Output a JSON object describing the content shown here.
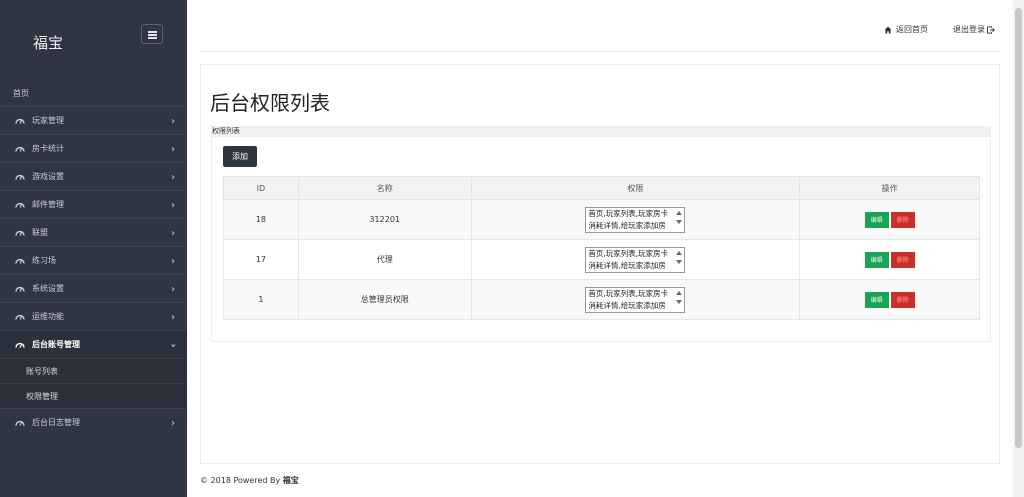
{
  "sidebar": {
    "brand": "福宝",
    "home": "首页",
    "items": [
      {
        "label": "玩家管理"
      },
      {
        "label": "房卡统计"
      },
      {
        "label": "游戏设置"
      },
      {
        "label": "邮件管理"
      },
      {
        "label": "联盟"
      },
      {
        "label": "练习场"
      },
      {
        "label": "系统设置"
      },
      {
        "label": "运维功能"
      },
      {
        "label": "后台账号管理"
      }
    ],
    "sub_items": [
      {
        "label": "账号列表"
      },
      {
        "label": "权限管理"
      }
    ],
    "last_item": {
      "label": "后台日志管理"
    }
  },
  "topbar": {
    "home_label": "返回首页",
    "logout_label": "退出登录"
  },
  "main": {
    "title": "后台权限列表",
    "section_label": "权限列表",
    "add_label": "添加",
    "columns": [
      "ID",
      "名称",
      "权限",
      "操作"
    ],
    "rows": [
      {
        "id": "18",
        "name": "312201",
        "perm": "首页,玩家列表,玩家房卡消耗详情,给玩家添加房",
        "edit": "编辑",
        "del": "删除"
      },
      {
        "id": "17",
        "name": "代理",
        "perm": "首页,玩家列表,玩家房卡消耗详情,给玩家添加房",
        "edit": "编辑",
        "del": "删除"
      },
      {
        "id": "1",
        "name": "总管理员权限",
        "perm": "首页,玩家列表,玩家房卡消耗详情,给玩家添加房",
        "edit": "编辑",
        "del": "删除"
      }
    ]
  },
  "footer": {
    "text": "© 2018 Powered By ",
    "brand": "福宝"
  },
  "colors": {
    "sidebar_bg": "#2f3542",
    "edit_btn": "#18a558",
    "delete_btn": "#c9302c"
  }
}
